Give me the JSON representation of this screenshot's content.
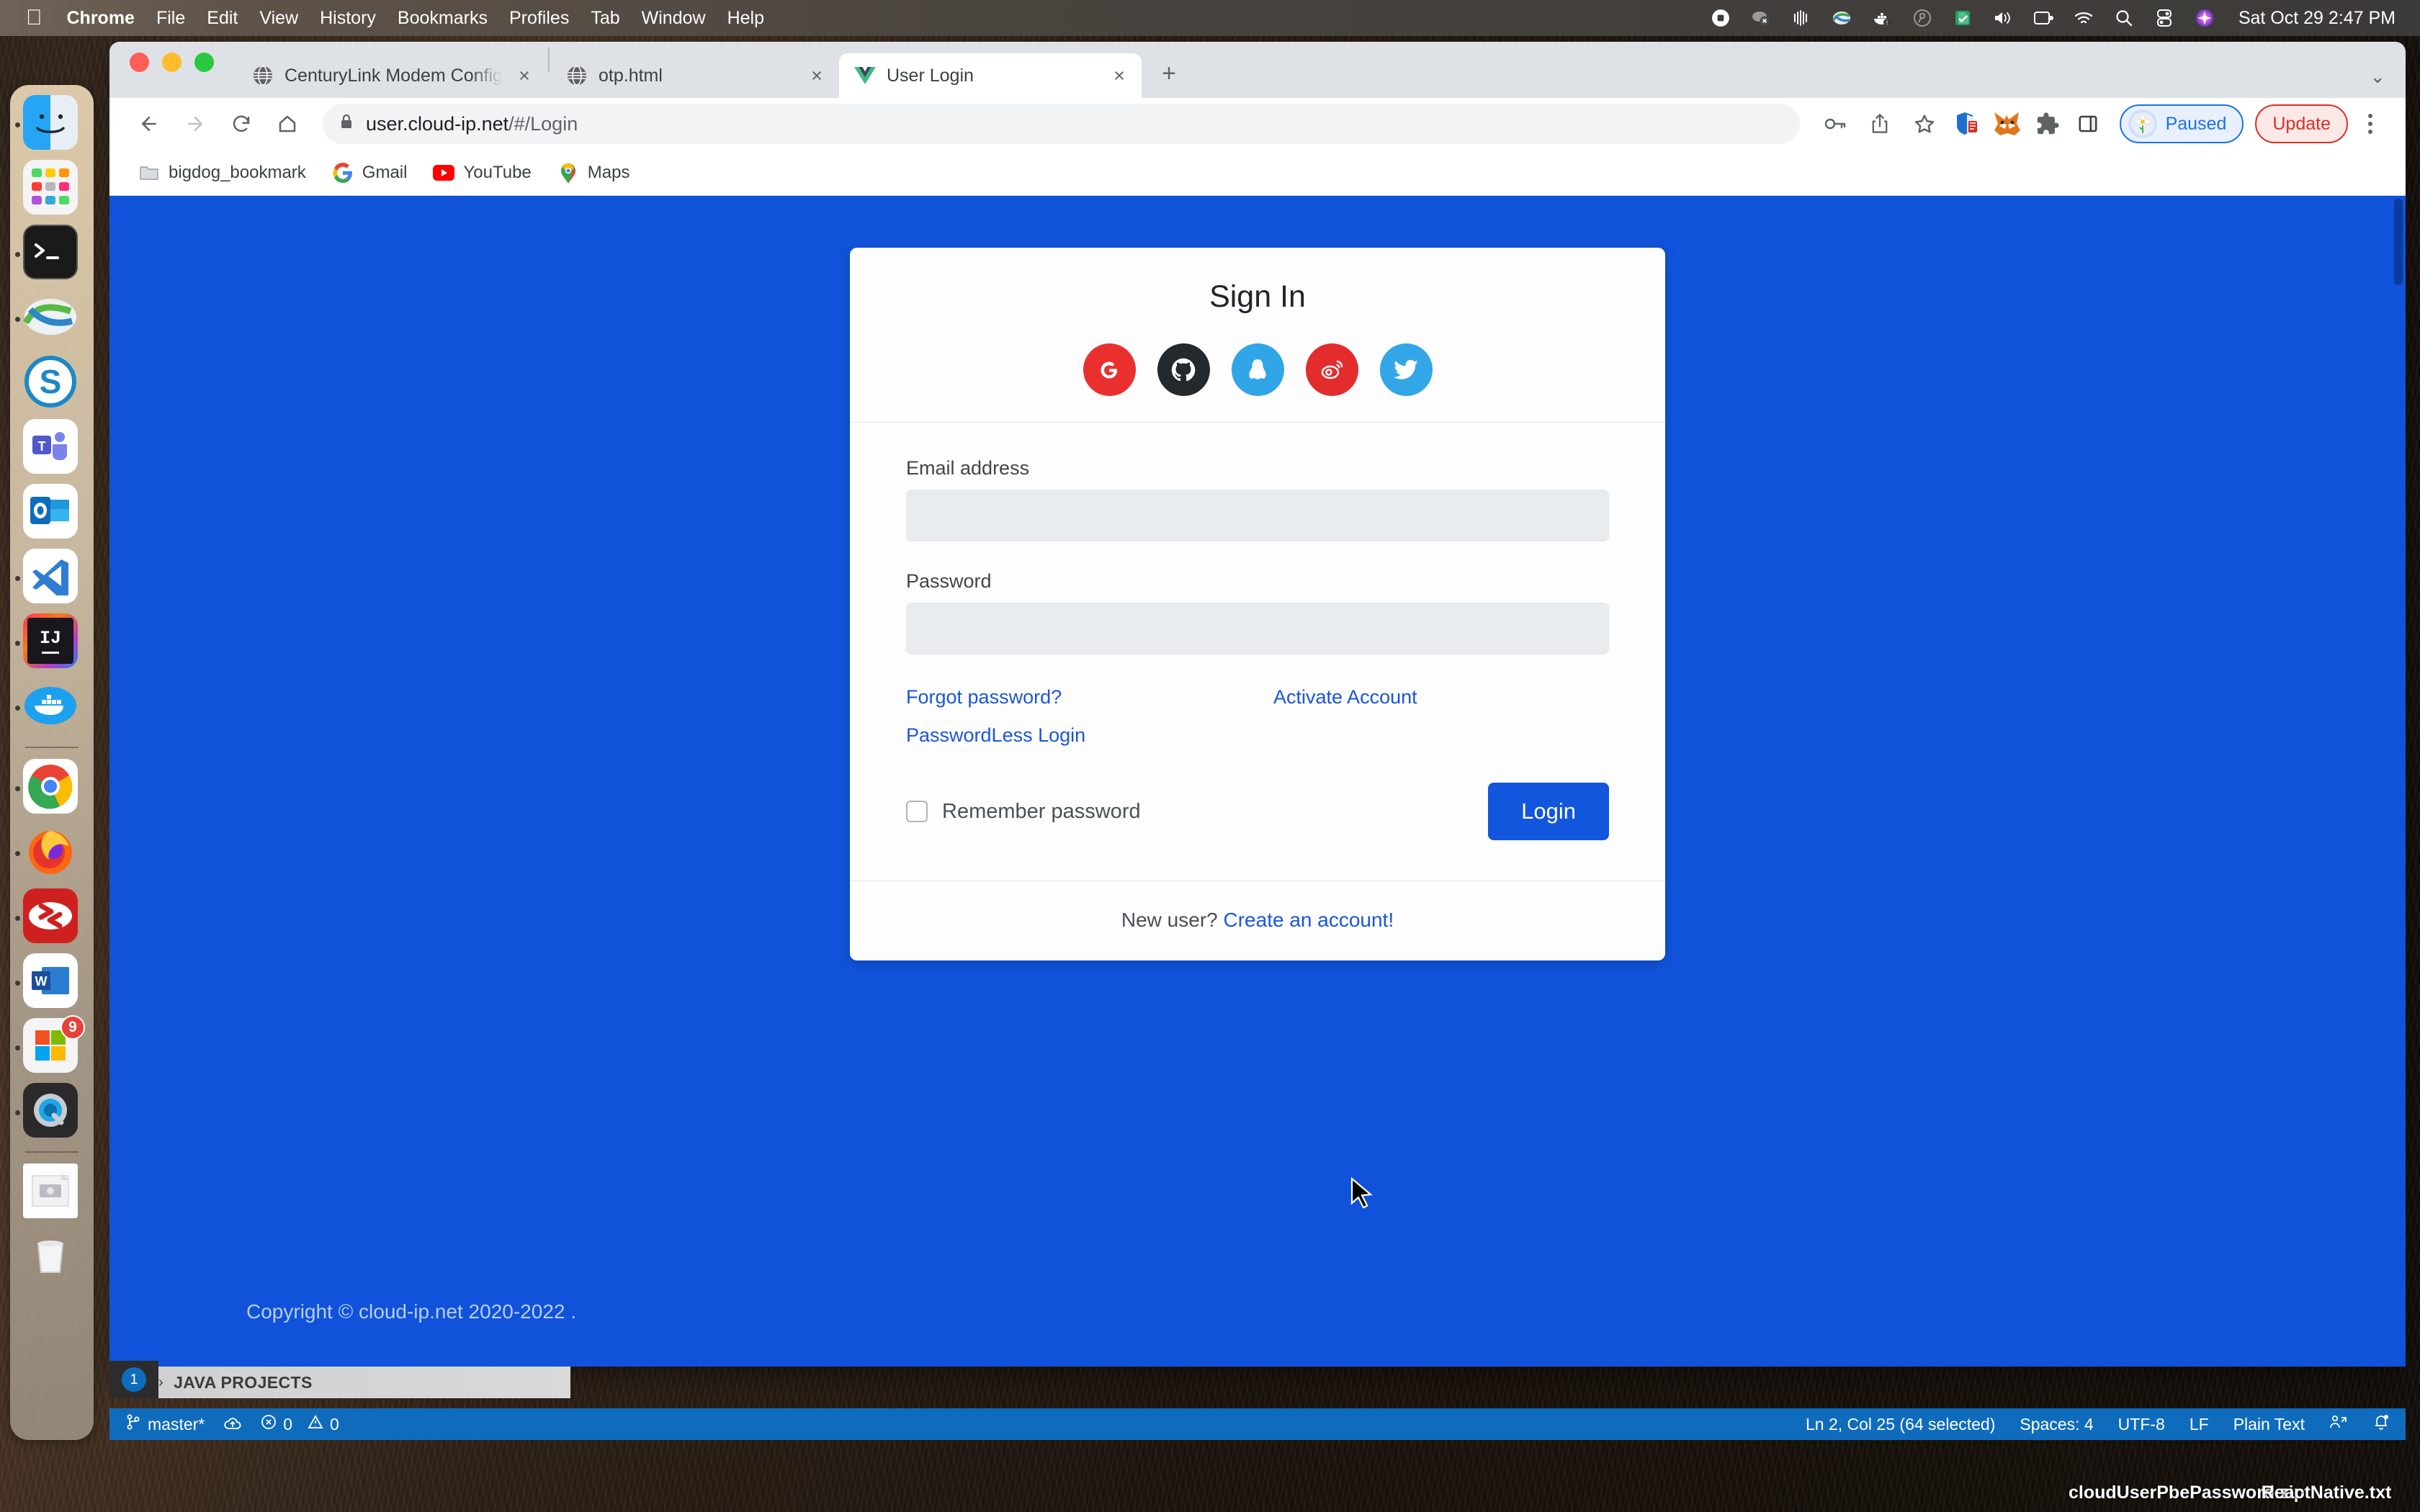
{
  "menubar": {
    "apple_icon": "apple-icon",
    "items": [
      {
        "label": "Chrome",
        "bold": true
      },
      {
        "label": "File",
        "bold": false
      },
      {
        "label": "Edit",
        "bold": false
      },
      {
        "label": "View",
        "bold": false
      },
      {
        "label": "History",
        "bold": false
      },
      {
        "label": "Bookmarks",
        "bold": false
      },
      {
        "label": "Profiles",
        "bold": false
      },
      {
        "label": "Tab",
        "bold": false
      },
      {
        "label": "Window",
        "bold": false
      },
      {
        "label": "Help",
        "bold": false
      }
    ],
    "status_icons": [
      "record-icon",
      "cloud-off-icon",
      "equalizer-icon",
      "tunnelblick-icon",
      "docker-icon",
      "search-grey-icon",
      "green-check-icon",
      "volume-icon",
      "display-icon",
      "wifi-icon",
      "spotlight-search-icon",
      "control-center-icon",
      "siri-icon"
    ],
    "clock": "Sat Oct 29  2:47 PM"
  },
  "dock": {
    "items": [
      {
        "name": "finder",
        "running": true
      },
      {
        "name": "launchpad",
        "running": false
      },
      {
        "name": "terminal",
        "running": true
      },
      {
        "name": "sourcetree",
        "running": true
      },
      {
        "name": "skype",
        "running": false
      },
      {
        "name": "microsoft-teams",
        "running": false
      },
      {
        "name": "microsoft-outlook",
        "running": false
      },
      {
        "name": "visual-studio-code",
        "running": true
      },
      {
        "name": "intellij-idea",
        "running": true
      },
      {
        "name": "docker",
        "running": true
      },
      {
        "name": "google-chrome",
        "running": true
      },
      {
        "name": "firefox",
        "running": true
      },
      {
        "name": "sublime-merge",
        "running": true
      },
      {
        "name": "microsoft-word",
        "running": true
      },
      {
        "name": "microsoft-office",
        "running": true,
        "badge": "9"
      },
      {
        "name": "quicktime-player",
        "running": true
      },
      {
        "name": "disk-image",
        "running": false
      },
      {
        "name": "trash",
        "running": false
      }
    ]
  },
  "browser": {
    "tabs": [
      {
        "title": "CenturyLink Modem Configura",
        "favicon": "globe-icon",
        "active": false
      },
      {
        "title": "otp.html",
        "favicon": "globe-icon",
        "active": false
      },
      {
        "title": "User Login",
        "favicon": "vue-icon",
        "active": true
      }
    ],
    "new_tab_label": "+",
    "tab_close_label": "×",
    "tabstrip_menu_icon": "chevron-down-icon",
    "nav": {
      "back_icon": "back-arrow-icon",
      "forward_icon": "forward-arrow-icon",
      "reload_icon": "reload-icon",
      "home_icon": "home-icon"
    },
    "omnibox": {
      "lock_icon": "lock-icon",
      "url_host": "user.cloud-ip.net",
      "url_path": "/#/Login"
    },
    "toolbar_right": {
      "password_icon": "key-icon",
      "share_icon": "share-icon",
      "bookmark_icon": "star-icon",
      "extensions": [
        "adblock-icon",
        "metamask-fox-icon",
        "puzzle-piece-icon",
        "side-panel-icon"
      ],
      "profile_label": "Paused",
      "profile_avatar_icon": "daisy-flower-avatar-icon",
      "update_label": "Update",
      "menu_icon": "kebab-menu-icon"
    },
    "bookmarks": [
      {
        "label": "bigdog_bookmark",
        "icon": "folder-icon"
      },
      {
        "label": "Gmail",
        "icon": "google-g-icon"
      },
      {
        "label": "YouTube",
        "icon": "youtube-icon"
      },
      {
        "label": "Maps",
        "icon": "google-maps-pin-icon"
      }
    ]
  },
  "page": {
    "background_color": "#1053da",
    "card": {
      "title": "Sign In",
      "social_logins": [
        {
          "name": "google",
          "color": "#ea2f2f",
          "glyph": "G"
        },
        {
          "name": "github",
          "color": "#24292e",
          "glyph": "github-icon"
        },
        {
          "name": "qq",
          "color": "#30a5e8",
          "glyph": "qq-penguin-icon"
        },
        {
          "name": "weibo",
          "color": "#e32d2d",
          "glyph": "weibo-icon"
        },
        {
          "name": "twitter",
          "color": "#33a6e8",
          "glyph": "twitter-bird-icon"
        }
      ],
      "fields": [
        {
          "label": "Email address",
          "value": "",
          "placeholder": "",
          "type": "email"
        },
        {
          "label": "Password",
          "value": "",
          "placeholder": "",
          "type": "password"
        }
      ],
      "links": {
        "forgot_password": "Forgot password?",
        "passwordless_login": "PasswordLess Login",
        "activate_account": "Activate Account"
      },
      "remember_label": "Remember password",
      "remember_checked": false,
      "login_button": "Login",
      "footer_text": "New user?",
      "footer_link": "Create an account!",
      "accent_color": "#1156dd",
      "link_color": "#1a56db"
    },
    "copyright": "Copyright © cloud-ip.net 2020-2022 ."
  },
  "vscode": {
    "explorer_section": "JAVA PROJECTS",
    "explorer_arrow": "›",
    "badge_count": "1",
    "status_left": {
      "branch_icon": "source-control-branch-icon",
      "branch": "master*",
      "sync_icon": "cloud-sync-icon",
      "errors_icon": "error-circle-icon",
      "errors": "0",
      "warnings_icon": "warning-triangle-icon",
      "warnings": "0"
    },
    "status_right": {
      "cursor_position": "Ln 2, Col 25 (64 selected)",
      "indentation": "Spaces: 4",
      "encoding": "UTF-8",
      "eol": "LF",
      "language": "Plain Text",
      "live_share_icon": "live-share-icon",
      "bell_icon": "notification-bell-dot-icon"
    }
  },
  "desktop_files": [
    {
      "name": "cloudUserPbePassword.zip"
    },
    {
      "name": "ReactNative.txt"
    }
  ]
}
